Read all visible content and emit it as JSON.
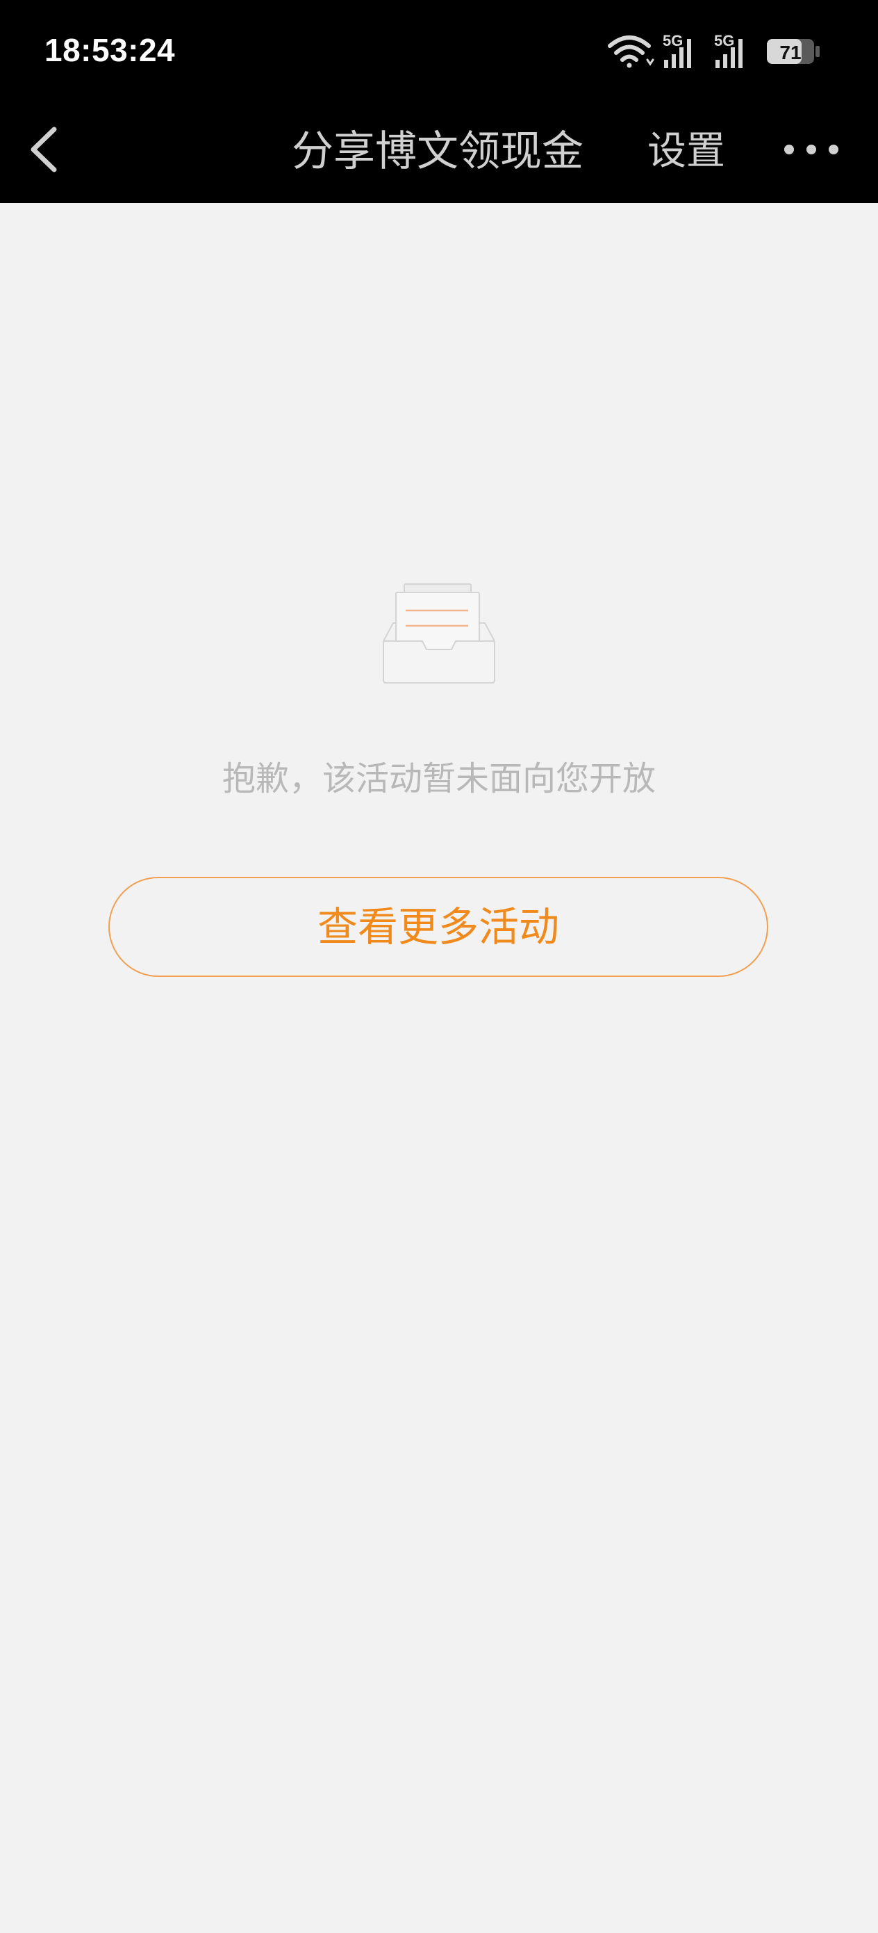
{
  "status_bar": {
    "time": "18:53:24",
    "network_1": "5G",
    "network_2": "5G",
    "battery": "71",
    "icons": [
      "wifi-icon",
      "cellular-signal-icon",
      "cellular-signal-icon",
      "battery-icon"
    ]
  },
  "nav": {
    "back_icon": "chevron-left-icon",
    "title": "分享博文领现金",
    "settings_label": "设置",
    "more_icon": "more-dots-icon"
  },
  "empty_state": {
    "icon": "empty-inbox-icon",
    "message": "抱歉，该活动暂未面向您开放",
    "button_label": "查看更多活动"
  },
  "colors": {
    "top_bar": "#000000",
    "background": "#f2f2f2",
    "accent": "#f08a1c",
    "muted_text": "#b8b8b8"
  }
}
